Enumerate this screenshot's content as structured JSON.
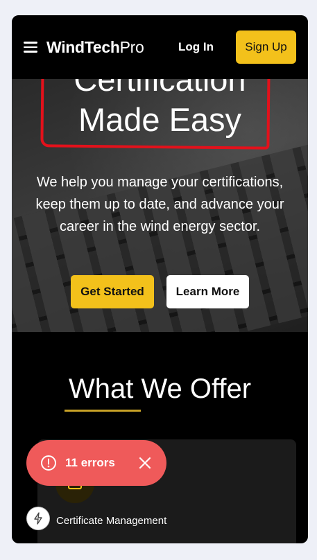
{
  "header": {
    "logo_bold": "WindTech",
    "logo_light": "Pro",
    "login_label": "Log In",
    "signup_label": "Sign Up"
  },
  "hero": {
    "title_line1": "Certification",
    "title_line2": "Made Easy",
    "description": "We help you manage your certifications, keep them up to date, and advance your career in the wind energy sector.",
    "get_started_label": "Get Started",
    "learn_more_label": "Learn More"
  },
  "offer": {
    "title": "What We Offer",
    "card_label": "Certificate Management"
  },
  "toast": {
    "errors_label": "11 errors"
  },
  "colors": {
    "accent": "#f3c11b",
    "annotation": "#e3111b",
    "error": "#ef5a5a"
  }
}
